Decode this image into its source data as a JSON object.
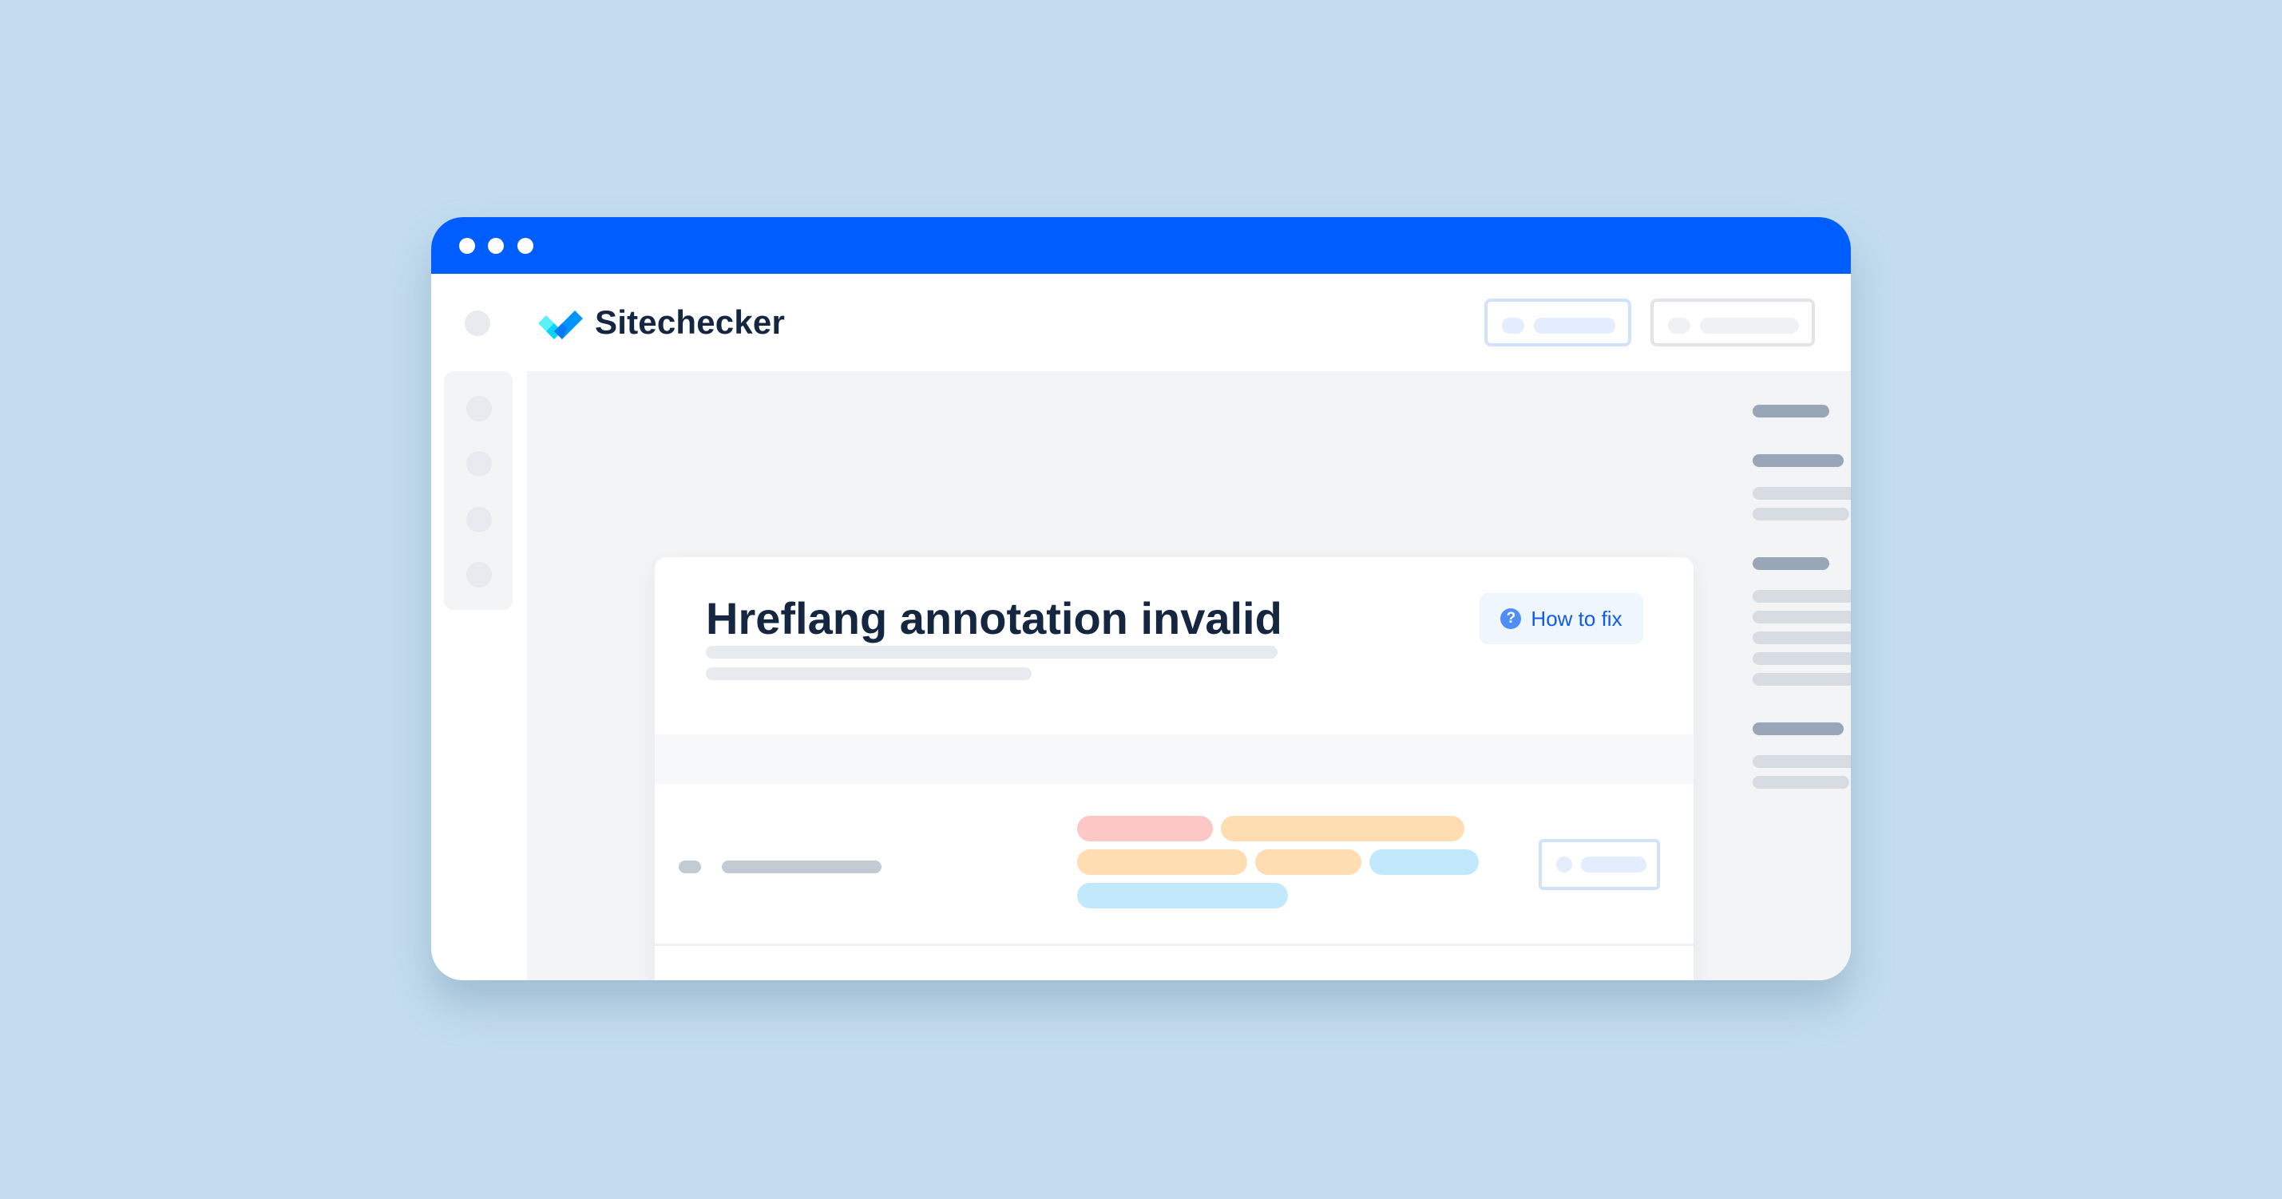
{
  "window": {
    "titlebar_color": "#005DFF",
    "controls": [
      "window-dot",
      "window-dot",
      "window-dot"
    ]
  },
  "header": {
    "brand": "Sitechecker",
    "logo_icon": "sitechecker-checkmark-icon",
    "buttons": [
      {
        "name": "header-button-primary",
        "style": "blue-outline"
      },
      {
        "name": "header-button-secondary",
        "style": "gray-outline"
      }
    ]
  },
  "sidebar": {
    "items": [
      "nav-item-1",
      "nav-item-2",
      "nav-item-3",
      "nav-item-4"
    ]
  },
  "issue": {
    "title": "Hreflang annotation invalid",
    "how_to_fix_label": "How to fix",
    "how_to_fix_icon": "question-circle-icon",
    "how_to_fix_icon_glyph": "?"
  },
  "table": {
    "rows": [
      {
        "chips": [
          [
            "red",
            "orange"
          ],
          [
            "orange",
            "orange",
            "blue"
          ],
          [
            "blue"
          ]
        ]
      },
      {
        "chips": [
          [
            "red",
            "red"
          ],
          [
            "orange",
            "orange"
          ]
        ]
      }
    ]
  },
  "side_panel": {
    "sections": [
      {
        "badge": "gray",
        "items": 0
      },
      {
        "badge": "red",
        "items": 2
      },
      {
        "badge": "orange",
        "items": 5
      },
      {
        "badge": "blue",
        "items": 2
      }
    ]
  },
  "colors": {
    "accent": "#005DFF",
    "link": "#0F5BEA",
    "error": "#FCC7C4",
    "warning": "#FEDDB3",
    "notice": "#C2E8FC",
    "background": "#C3DDEF"
  }
}
